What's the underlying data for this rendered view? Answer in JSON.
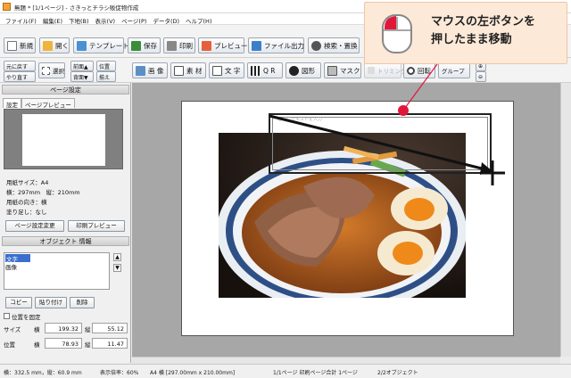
{
  "window": {
    "title": "無題 * [1/1ページ] - さきっとチラシ販促物作成"
  },
  "menu": [
    "ファイル(F)",
    "編集(E)",
    "下地(B)",
    "表示(V)",
    "ページ(P)",
    "データ(D)",
    "ヘルプ(H)"
  ],
  "toolbar1": {
    "new": "新規",
    "open": "開く",
    "template": "テンプレート",
    "save": "保存",
    "print": "印刷",
    "preview": "プレビュー",
    "file_output": "ファイル出力",
    "search_replace": "検索・置換"
  },
  "toolbar2": {
    "undo": "元に戻す",
    "redo": "やり直す",
    "select": "選択",
    "front": "前面▲",
    "back": "背面▼",
    "align_top": "位置",
    "align_bottom": "揃え",
    "image": "画 像",
    "material": "素 材",
    "text": "文 字",
    "qr": "Q R",
    "shape": "図形",
    "mask": "マスク",
    "trimming": "トリミング",
    "rotate": "回転",
    "group": "グループ"
  },
  "page_settings": {
    "header": "ページ設定",
    "tab_settings": "設定",
    "tab_preview": "ページプレビュー",
    "paper_size": "用紙サイズ：A4",
    "dimensions": "横：297mm　縦：210mm",
    "orientation": "用紙の向き：横",
    "bleed": "塗り足し：なし",
    "change_button": "ページ設定変更",
    "print_preview_button": "印刷プレビュー"
  },
  "object_info": {
    "header": "オブジェクト 情報",
    "items": [
      "文字",
      "画像"
    ],
    "copy_button": "コピー",
    "paste_button": "貼り付け",
    "delete_button": "削除",
    "fix_position_label": "位置を固定",
    "size_label": "サイズ",
    "position_label": "位置",
    "width_label": "横",
    "height_label": "縦",
    "size_w": "199.32",
    "size_h": "55.12",
    "pos_x": "78.93",
    "pos_y": "11.47"
  },
  "canvas": {
    "placeholder_text": "ここにテキストを入力",
    "image_name": "ramen-photo"
  },
  "callout": {
    "line1": "マウスの左ボタンを",
    "line2": "押したまま移動"
  },
  "statusbar": {
    "cursor": "横：332.5 mm，縦：60.9 mm",
    "zoom": "表示倍率：60%",
    "paper": "A4 横 [297.00mm x 210.00mm]",
    "pages": "1/1ページ  印刷ページ合計 1ページ",
    "objects": "2/2オブジェクト"
  },
  "colors": {
    "accent_red": "#e1173a",
    "callout_bg": "#fce9d8"
  }
}
